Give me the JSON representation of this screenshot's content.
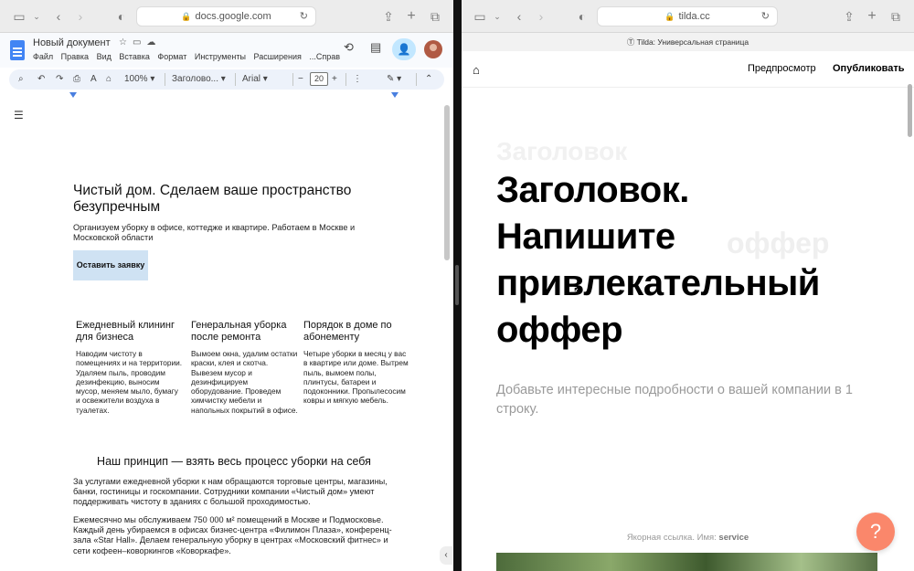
{
  "left_browser": {
    "url": "docs.google.com",
    "icons": [
      "sidebar-icon",
      "chevron-down-icon",
      "back-icon",
      "forward-icon",
      "shield-icon",
      "share-icon",
      "new-tab-icon",
      "tabs-icon"
    ]
  },
  "right_browser": {
    "url": "tilda.cc",
    "banner": "Tilda: Универсальная страница"
  },
  "gdocs": {
    "doc_title": "Новый документ",
    "menu": [
      "Файл",
      "Правка",
      "Вид",
      "Вставка",
      "Формат",
      "Инструменты",
      "Расширения",
      "...Справ"
    ],
    "toolbar": {
      "zoom": "100%",
      "style": "Заголово...",
      "font": "Arial",
      "font_size": "20"
    }
  },
  "document": {
    "heading": "Чистый дом. Сделаем ваше пространство безупречным",
    "subheading": "Организуем уборку в офисе, коттедже и квартире. Работаем в Москве и Московской области",
    "cta": "Оставить заявку",
    "columns": [
      {
        "title": "Ежедневный клининг для бизнеса",
        "text": "Наводим чистоту в помещениях и на территории. Удаляем пыль, проводим дезинфекцию, выносим мусор, меняем мыло, бумагу и освежители воздуха в туалетах."
      },
      {
        "title": "Генеральная уборка после ремонта",
        "text": "Вымоем окна, удалим остатки краски, клея и скотча. Вывезем мусор и дезинфицируем оборудование. Проведем химчистку мебели и напольных покрытий в офисе."
      },
      {
        "title": "Порядок в доме по абонементу",
        "text": "Четыре уборки в месяц у вас в квартире или доме. Вытрем пыль, вымоем полы, плинтусы, батареи и подоконники. Пропылесосим ковры и мягкую мебель."
      }
    ],
    "section_title": "Наш принцип — взять весь процесс уборки на себя",
    "para1": "За услугами ежедневной уборки к нам обращаются торговые центры, магазины, банки, гостиницы и госкомпании. Сотрудники компании «Чистый дом» умеют поддерживать чистоту в зданиях с большой проходимостью.",
    "para2": "Ежемесячно мы обслуживаем 750 000 м² помещений в Москве и Подмосковье. Каждый день убираемся в офисах бизнес-центра «Филимон Плаза», конференц-зала «Star Hall». Делаем генеральную уборку в центрах «Московский фитнес» и сети кофеен–коворкингов «Коворкафе»."
  },
  "tilda": {
    "preview": "Предпросмотр",
    "publish": "Опубликовать",
    "heading": "Заголовок. Напишите привлекательный оффер",
    "subtitle": "Добавьте интересные подробности о вашей компании в 1 строку.",
    "anchor_label": "Якорная ссылка. Имя:",
    "anchor_name": "service",
    "help": "?"
  },
  "colors": {
    "docs_blue": "#4285f4",
    "share_button": "#c2e7ff",
    "cta_bg": "#cfe2f3",
    "help_button": "#fa876b"
  }
}
